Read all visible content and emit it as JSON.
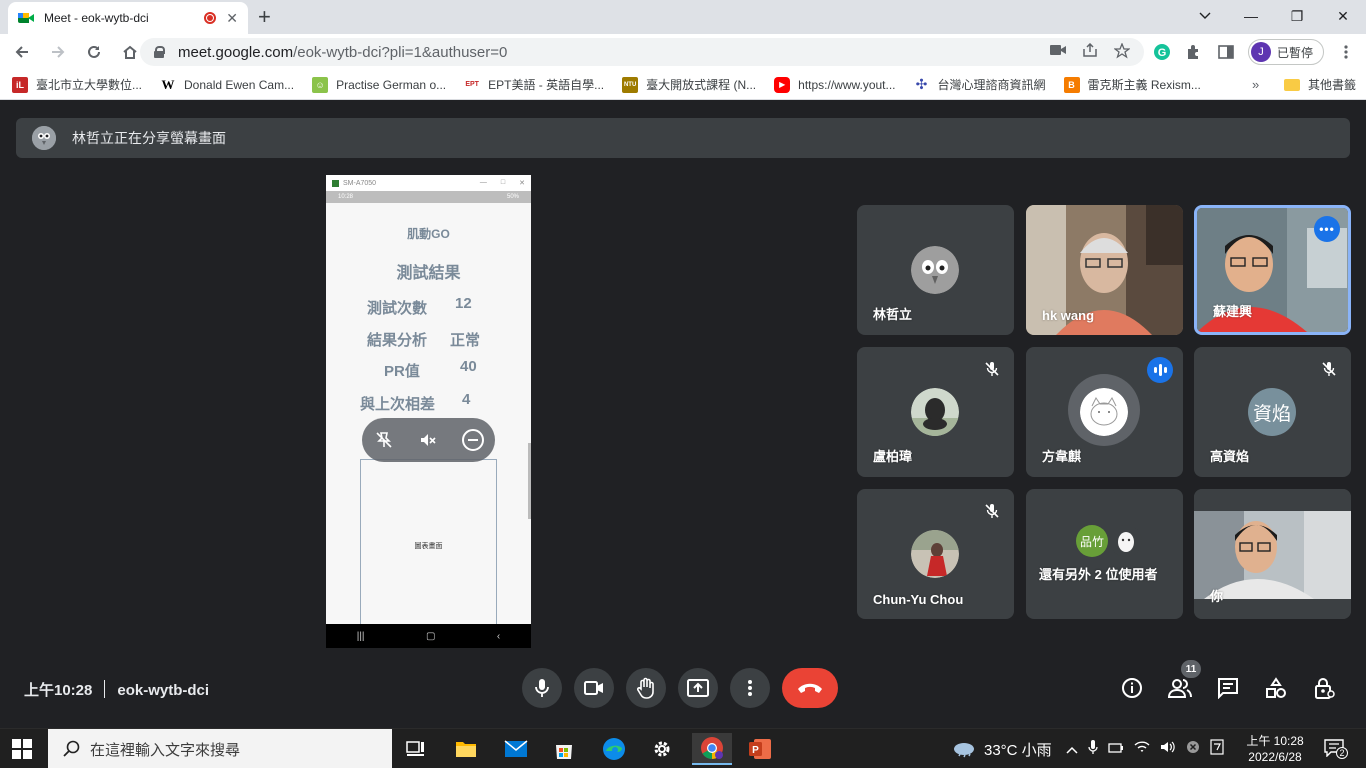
{
  "browser": {
    "tab_title": "Meet - eok-wytb-dci",
    "tab_close": "✕",
    "new_tab": "+",
    "url_host": "meet.google.com",
    "url_path": "/eok-wytb-dci?pli=1&authuser=0",
    "profile_initial": "J",
    "profile_label": "已暫停",
    "window_controls": {
      "minimize": "—",
      "restore": "❐",
      "close": "✕"
    }
  },
  "bookmarks": {
    "items": [
      {
        "label": "臺北市立大學數位...",
        "icon_text": "iL",
        "color": "#c62828"
      },
      {
        "label": "Donald Ewen Cam...",
        "icon_text": "W",
        "color": "#ffffff"
      },
      {
        "label": "Practise German o...",
        "icon_text": "☺",
        "color": "#8bc34a"
      },
      {
        "label": "EPT美語 - 英語自學...",
        "icon_text": "EPT",
        "color": "#c62828"
      },
      {
        "label": "臺大開放式課程 (N...",
        "icon_text": "NTU",
        "color": "#9e7b00"
      },
      {
        "label": "https://www.yout...",
        "icon_text": "▶",
        "color": "#ff0000"
      },
      {
        "label": "台灣心理諮商資訊網",
        "icon_text": "✣",
        "color": "#3949ab"
      },
      {
        "label": "雷克斯主義 Rexism...",
        "icon_text": "B",
        "color": "#f57c00"
      }
    ],
    "more": "»",
    "other": "其他書籤"
  },
  "meet": {
    "presenting_banner": "林哲立正在分享螢幕畫面",
    "presentation": {
      "window_title": "SM-A7050",
      "status_time": "10:28",
      "status_right": "50%",
      "app_name": "肌動GO",
      "heading": "測試結果",
      "rows": [
        {
          "label": "測試次數",
          "value": "12"
        },
        {
          "label": "結果分析",
          "value": "正常"
        },
        {
          "label": "PR值",
          "value": "40"
        },
        {
          "label": "與上次相差",
          "value": "4"
        }
      ],
      "chart_placeholder": "圖表畫面"
    },
    "participants": [
      {
        "name": "林哲立",
        "type": "avatar-bird",
        "muted": false
      },
      {
        "name": "hk wang",
        "type": "video",
        "muted": false
      },
      {
        "name": "蘇建興",
        "type": "video",
        "muted": false,
        "active": true
      },
      {
        "name": "盧柏瑋",
        "type": "avatar-photo",
        "muted": true
      },
      {
        "name": "方韋麒",
        "type": "avatar-cat",
        "muted": false,
        "speaking": true
      },
      {
        "name": "高資焰",
        "type": "avatar-letter",
        "avatar_text": "資焰",
        "muted": true
      },
      {
        "name": "Chun-Yu Chou",
        "type": "avatar-photo",
        "muted": true
      },
      {
        "name": "還有另外 2 位使用者",
        "type": "others",
        "avatar_text": "品竹"
      },
      {
        "name": "你",
        "type": "video",
        "muted": false
      }
    ],
    "time": "上午10:28",
    "meeting_code": "eok-wytb-dci",
    "people_count": "11"
  },
  "taskbar": {
    "search_placeholder": "在這裡輸入文字來搜尋",
    "weather": "33°C 小雨",
    "clock_time": "上午 10:28",
    "clock_date": "2022/6/28",
    "notification_count": "2"
  }
}
